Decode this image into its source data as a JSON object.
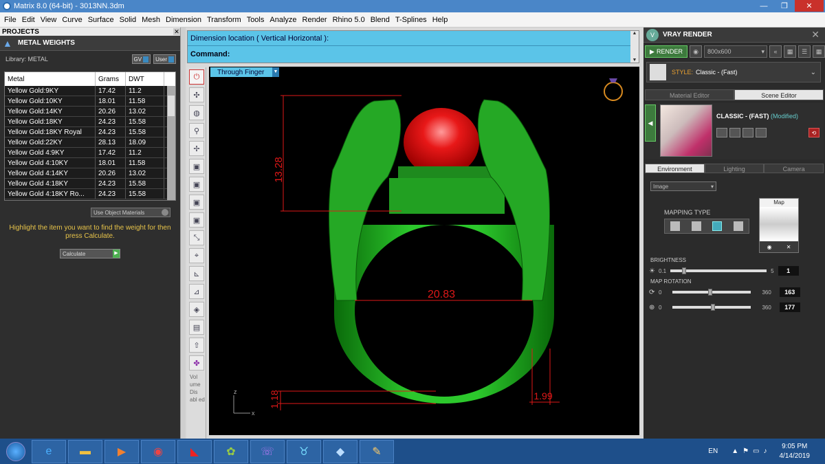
{
  "window": {
    "title": "Matrix 8.0 (64-bit) - 3013NN.3dm",
    "min": "—",
    "max": "❐",
    "close": "✕"
  },
  "menu": [
    "File",
    "Edit",
    "View",
    "Curve",
    "Surface",
    "Solid",
    "Mesh",
    "Dimension",
    "Transform",
    "Tools",
    "Analyze",
    "Render",
    "Rhino 5.0",
    "Blend",
    "T-Splines",
    "Help"
  ],
  "left": {
    "projects_label": "PROJECTS",
    "panel_title": "METAL WEIGHTS",
    "library_label": "Library: METAL",
    "gv_label": "GV",
    "user_label": "User",
    "columns": [
      "Metal",
      "Grams",
      "DWT"
    ],
    "rows": [
      [
        "Yellow Gold:9KY",
        "17.42",
        "11.2"
      ],
      [
        "Yellow Gold:10KY",
        "18.01",
        "11.58"
      ],
      [
        "Yellow Gold:14KY",
        "20.26",
        "13.02"
      ],
      [
        "Yellow Gold:18KY",
        "24.23",
        "15.58"
      ],
      [
        "Yellow Gold:18KY Royal",
        "24.23",
        "15.58"
      ],
      [
        "Yellow Gold:22KY",
        "28.13",
        "18.09"
      ],
      [
        "Yellow Gold 4:9KY",
        "17.42",
        "11.2"
      ],
      [
        "Yellow Gold 4:10KY",
        "18.01",
        "11.58"
      ],
      [
        "Yellow Gold 4:14KY",
        "20.26",
        "13.02"
      ],
      [
        "Yellow Gold 4:18KY",
        "24.23",
        "15.58"
      ],
      [
        "Yellow Gold 4:18KY Ro...",
        "24.23",
        "15.58"
      ]
    ],
    "use_object_materials": "Use Object Materials",
    "hint": "Highlight the item you want to find the weight for then press Calculate.",
    "calculate": "Calculate"
  },
  "command": {
    "line1": "Dimension location ( Vertical  Horizontal ):",
    "line2": "Command:"
  },
  "toolbar": {
    "volume_text": "Vol ume Dis abl ed"
  },
  "viewport": {
    "view_mode": "Through Finger",
    "dims": {
      "height": "13.28",
      "width": "20.83",
      "bottom": "1.18",
      "side": "1.99"
    },
    "axis_z": "z",
    "axis_x": "x",
    "colors": {
      "ring": "#1fa81f",
      "stone": "#e01818",
      "dimension": "#e01818"
    }
  },
  "vray": {
    "title": "VRAY RENDER",
    "render_label": "RENDER",
    "resolution": "800x600",
    "style_label": "STYLE:",
    "style_value": "Classic - (Fast)",
    "tabs": [
      "Material Editor",
      "Scene Editor"
    ],
    "material_name": "CLASSIC - (FAST)",
    "material_modified": "(Modified)",
    "env_tabs": [
      "Environment",
      "Lighting",
      "Camera"
    ],
    "env_type": "Image",
    "mapping_type": "MAPPING TYPE",
    "map_label": "Map",
    "brightness_label": "BRIGHTNESS",
    "brightness": {
      "min": "0.1",
      "max": "5",
      "value": "1",
      "fraction": 0.12
    },
    "map_rotation_label": "MAP ROTATION",
    "rotation1": {
      "min": "0",
      "max": "360",
      "value": "163",
      "fraction": 0.45
    },
    "rotation2": {
      "min": "0",
      "max": "360",
      "value": "177",
      "fraction": 0.49
    }
  },
  "taskbar": {
    "lang": "EN",
    "time": "9:05 PM",
    "date": "4/14/2019"
  }
}
